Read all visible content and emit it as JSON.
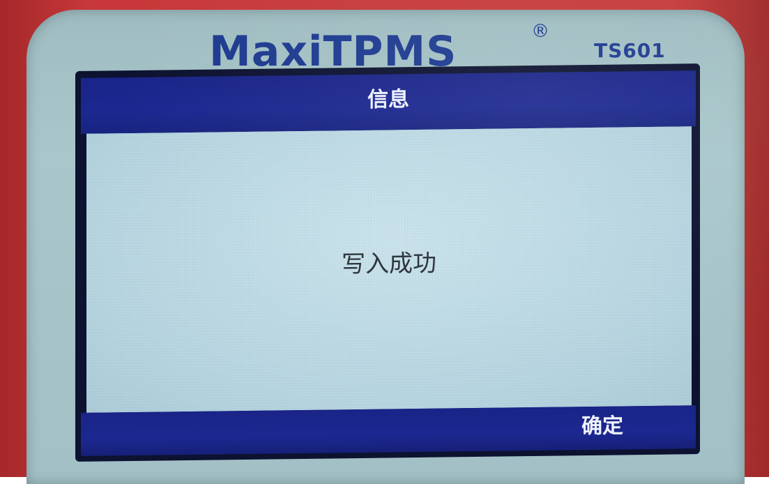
{
  "device": {
    "brand": "MaxiTPMS",
    "registered_mark": "®",
    "model": "TS601",
    "colors": {
      "housing": "#c53a3a",
      "bezel": "#a9c7cb",
      "brand_text": "#1d3a8f",
      "bar": "#1c2890",
      "screen_bg": "#b7d6e2"
    }
  },
  "dialog": {
    "title": "信息",
    "message": "写入成功",
    "confirm_label": "确定"
  }
}
